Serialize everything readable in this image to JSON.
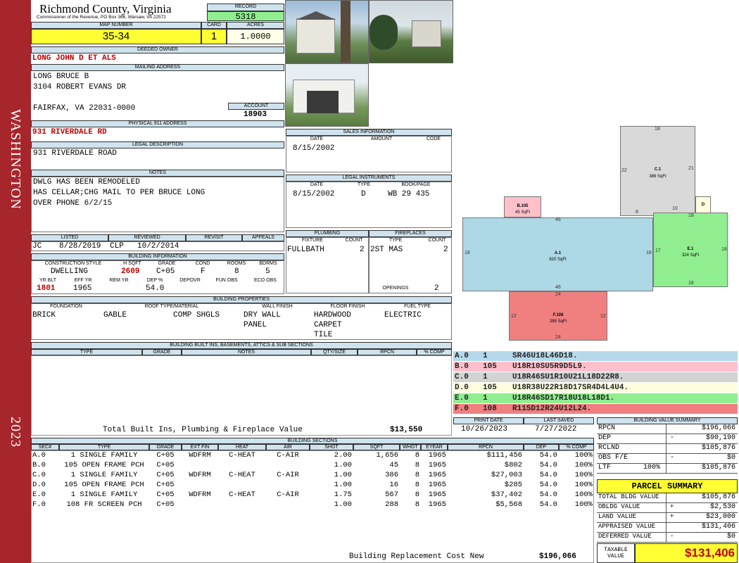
{
  "side": {
    "name": "WASHINGTON",
    "year": "2023"
  },
  "header": {
    "county": "Richmond County, Virginia",
    "commissioner": "Commissioner of the Revenue, PO Box 366, Warsaw, VA 22572",
    "record_label": "RECORD",
    "record": "5318",
    "map_label": "MAP NUMBER",
    "map": "35-34",
    "card_label": "CARD",
    "card": "1",
    "acres_label": "ACRES",
    "acres": "1.0000"
  },
  "owner": {
    "deeded_label": "DEEDED OWNER",
    "deeded": "LONG JOHN D ET ALS",
    "mailing_label": "MAILING ADDRESS",
    "mail1": "LONG BRUCE B",
    "mail2": "3104 ROBERT EVANS DR",
    "mail3": "FAIRFAX, VA 22031-0000",
    "account_label": "ACCOUNT",
    "account": "18903",
    "physical_label": "PHYSICAL 911 ADDRESS",
    "physical": "931 RIVERDALE RD",
    "legal_label": "LEGAL DESCRIPTION",
    "legal": "931 RIVERDALE ROAD"
  },
  "notes": {
    "label": "NOTES",
    "line1": "DWLG HAS BEEN REMODELED",
    "line2": "HAS CELLAR;CHG MAIL TO PER BRUCE LONG",
    "line3": "OVER PHONE 6/2/15"
  },
  "review": {
    "listed_label": "LISTED",
    "reviewed_label": "REVIEWED",
    "revisit_label": "REVISIT",
    "appeals_label": "APPEALS",
    "listed_by": "JC",
    "listed_date": "8/28/2019",
    "reviewed_by": "CLP",
    "reviewed_date": "10/2/2014"
  },
  "building_info": {
    "label": "BUILDING INFORMATION",
    "h_cs": "CONSTRUCTION STYLE",
    "h_sqft": "H SQFT",
    "h_grade": "GRADE",
    "h_cond": "COND",
    "h_rooms": "ROOMS",
    "h_bdrms": "BDRMS",
    "cs": "DWELLING",
    "sqft": "2609",
    "grade": "C+05",
    "cond": "F",
    "rooms": "8",
    "bdrms": "5",
    "h_yr": "YR BLT",
    "h_eff": "EFF YR",
    "h_rem": "REM YR",
    "h_dep": "DEP %",
    "h_depovr": "DEPOVR",
    "h_fun": "FUN OBS",
    "h_eco": "ECO OBS",
    "yr": "1801",
    "eff": "1965",
    "dep": "54.0"
  },
  "sales": {
    "label": "SALES INFORMATION",
    "h_date": "DATE",
    "h_amount": "AMOUNT",
    "h_code": "CODE",
    "date": "8/15/2002"
  },
  "legal_inst": {
    "label": "LEGAL INSTRUMENTS",
    "h_date": "DATE",
    "h_type": "TYPE",
    "h_book": "BOOK/PAGE",
    "date": "8/15/2002",
    "type": "D",
    "book": "WB 29 435"
  },
  "plumbing": {
    "label": "PLUMBING",
    "h_fixture": "FIXTURE",
    "h_count": "COUNT",
    "fixture": "FULLBATH",
    "count": "2"
  },
  "fireplaces": {
    "label": "FIREPLACES",
    "h_type": "TYPE",
    "h_count": "COUNT",
    "type": "2ST MAS",
    "count": "2",
    "openings_label": "OPENINGS",
    "openings": "2"
  },
  "props": {
    "label": "BUILDING PROPERTIES",
    "h_found": "FOUNDATION",
    "h_roof": "ROOF TYPE/MATERIAL",
    "h_wall": "WALL FINISH",
    "h_floor": "FLOOR FINISH",
    "h_fuel": "FUEL TYPE",
    "found": "BRICK",
    "roof1": "GABLE",
    "roof2": "COMP SHGLS",
    "wall1": "DRY WALL",
    "wall2": "PANEL",
    "floor1": "HARDWOOD",
    "floor2": "CARPET",
    "floor3": "TILE",
    "fuel": "ELECTRIC"
  },
  "builtins": {
    "label": "BUILDING BUILT INS, BASEMENTS, ATTICS & SUB SECTIONS",
    "h_type": "TYPE",
    "h_grade": "GRADE",
    "h_notes": "NOTES",
    "h_qty": "QTY/SIZE",
    "h_rpcn": "RPCN",
    "h_comp": "% COMP",
    "total_label": "Total Built Ins, Plumbing & Fireplace Value",
    "total": "$13,550"
  },
  "sketch": {
    "a_label": "A.1",
    "a_area": "820 SqFt",
    "b_label": "B.105",
    "b_area": "45 SqFt",
    "c_label": "C.1",
    "c_area": "386 SqFt",
    "d_label": "D",
    "e_label": "E.1",
    "e_area": "324 SqFt",
    "f_label": "F.108",
    "f_area": "288 SqFt",
    "dims": [
      "18",
      "22",
      "21",
      "8",
      "10",
      "18",
      "46",
      "18",
      "18",
      "17",
      "18",
      "18",
      "46",
      "24",
      "12",
      "12",
      "24"
    ]
  },
  "vectors": [
    {
      "id": "A.0",
      "code": "1",
      "vec": "SR46U18L46D18.",
      "color": "#b5d9ea"
    },
    {
      "id": "B.0",
      "code": "105",
      "vec": "U18R10SU5R9D5L9.",
      "color": "#ffc0cb"
    },
    {
      "id": "C.0",
      "code": "1",
      "vec": "U18R46SU1R10U21L18D22R8.",
      "color": "#d3d3d3"
    },
    {
      "id": "D.0",
      "code": "105",
      "vec": "U18R38U22R18D17SR4D4L4U4.",
      "color": "#ffffe0"
    },
    {
      "id": "E.0",
      "code": "1",
      "vec": "U18R46SD17R18U18L18D1.",
      "color": "#90ee90"
    },
    {
      "id": "F.0",
      "code": "108",
      "vec": "R11SD12R24U12L24.",
      "color": "#f08080"
    }
  ],
  "dates": {
    "print_label": "PRINT DATE",
    "print": "10/26/2023",
    "saved_label": "LAST SAVED",
    "saved": "7/27/2022"
  },
  "bvs": {
    "label": "BUILDING VALUE SUMMARY",
    "rpcn_l": "RPCN",
    "rpcn": "$196,066",
    "dep_l": "DEP",
    "dep_sign": "-",
    "dep": "$90,190",
    "rclnd_l": "RCLND",
    "rclnd": "$105,876",
    "obs_l": "OBS F/E",
    "obs_sign": "-",
    "obs": "$0",
    "ltf_l": "LTF",
    "ltf_pct": "100%",
    "ltf": "$105,876"
  },
  "parcel": {
    "label": "PARCEL SUMMARY",
    "tbv_l": "TOTAL BLDG VALUE",
    "tbv": "$105,876",
    "obldg_l": "OBLDG VALUE",
    "obldg_sign": "+",
    "obldg": "$2,530",
    "land_l": "LAND VALUE",
    "land_sign": "+",
    "land": "$23,000",
    "appr_l": "APPRAISED VALUE",
    "appr": "$131,406",
    "def_l": "DEFERRED VALUE",
    "def_sign": "-",
    "def": "$0",
    "tax_l1": "TAXABLE",
    "tax_l2": "VALUE",
    "tax": "$131,406"
  },
  "sections": {
    "label": "BUILDING SECTIONS",
    "headers": [
      "SEC#",
      "TYPE",
      "GRADE",
      "EXT FIN",
      "HEAT",
      "AIR",
      "SHGT",
      "SQFT",
      "WHGT",
      "EYEAR",
      "RPCN",
      "DEP",
      "% COMP"
    ],
    "rows": [
      [
        "A.0",
        "1 SINGLE FAMILY",
        "C+05",
        "WDFRM",
        "C-HEAT",
        "C-AIR",
        "2.00",
        "1,656",
        "8",
        "1965",
        "$111,456",
        "54.0",
        "100%"
      ],
      [
        "B.0",
        "105 OPEN FRAME PCH",
        "C+05",
        "",
        "",
        "",
        "1.00",
        "45",
        "8",
        "1965",
        "$802",
        "54.0",
        "100%"
      ],
      [
        "C.0",
        "1 SINGLE FAMILY",
        "C+05",
        "WDFRM",
        "C-HEAT",
        "C-AIR",
        "1.00",
        "386",
        "8",
        "1965",
        "$27,003",
        "54.0",
        "100%"
      ],
      [
        "D.0",
        "105 OPEN FRAME PCH",
        "C+05",
        "",
        "",
        "",
        "1.00",
        "16",
        "8",
        "1965",
        "$285",
        "54.0",
        "100%"
      ],
      [
        "E.0",
        "1 SINGLE FAMILY",
        "C+05",
        "WDFRM",
        "C-HEAT",
        "C-AIR",
        "1.75",
        "567",
        "8",
        "1965",
        "$37,402",
        "54.0",
        "100%"
      ],
      [
        "F.0",
        "108 FR SCREEN PCH",
        "C+05",
        "",
        "",
        "",
        "1.00",
        "288",
        "8",
        "1965",
        "$5,568",
        "54.0",
        "100%"
      ]
    ],
    "total_label": "Building Replacement Cost New",
    "total": "$196,066"
  }
}
